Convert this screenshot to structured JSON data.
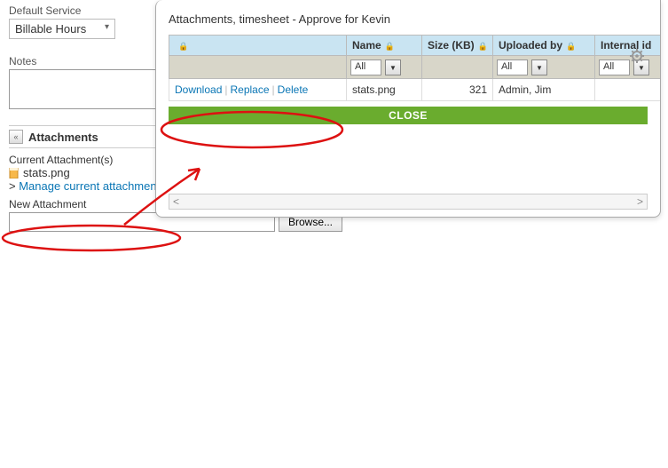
{
  "page": {
    "default_service_label": "Default Service",
    "default_service_value": "Billable Hours",
    "notes_label": "Notes",
    "notes_value": "",
    "attachments_header": "Attachments",
    "current_attach_label": "Current Attachment(s)",
    "current_file_name": "stats.png",
    "manage_link_prefix": "> ",
    "manage_link_text": "Manage current attachment(s)",
    "new_attach_label": "New Attachment",
    "browse_button": "Browse...",
    "browse_value": ""
  },
  "modal": {
    "title": "Attachments, timesheet - Approve for Kevin",
    "columns": {
      "actions": "",
      "name": "Name",
      "size": "Size (KB)",
      "uploaded_by": "Uploaded by",
      "internal_id": "Internal id"
    },
    "filters": {
      "name": "All",
      "uploaded_by": "All",
      "internal_id": "All"
    },
    "row": {
      "actions": {
        "download": "Download",
        "replace": "Replace",
        "delete": "Delete"
      },
      "name": "stats.png",
      "size": "321",
      "uploaded_by": "Admin, Jim"
    },
    "close_button": "CLOSE"
  }
}
